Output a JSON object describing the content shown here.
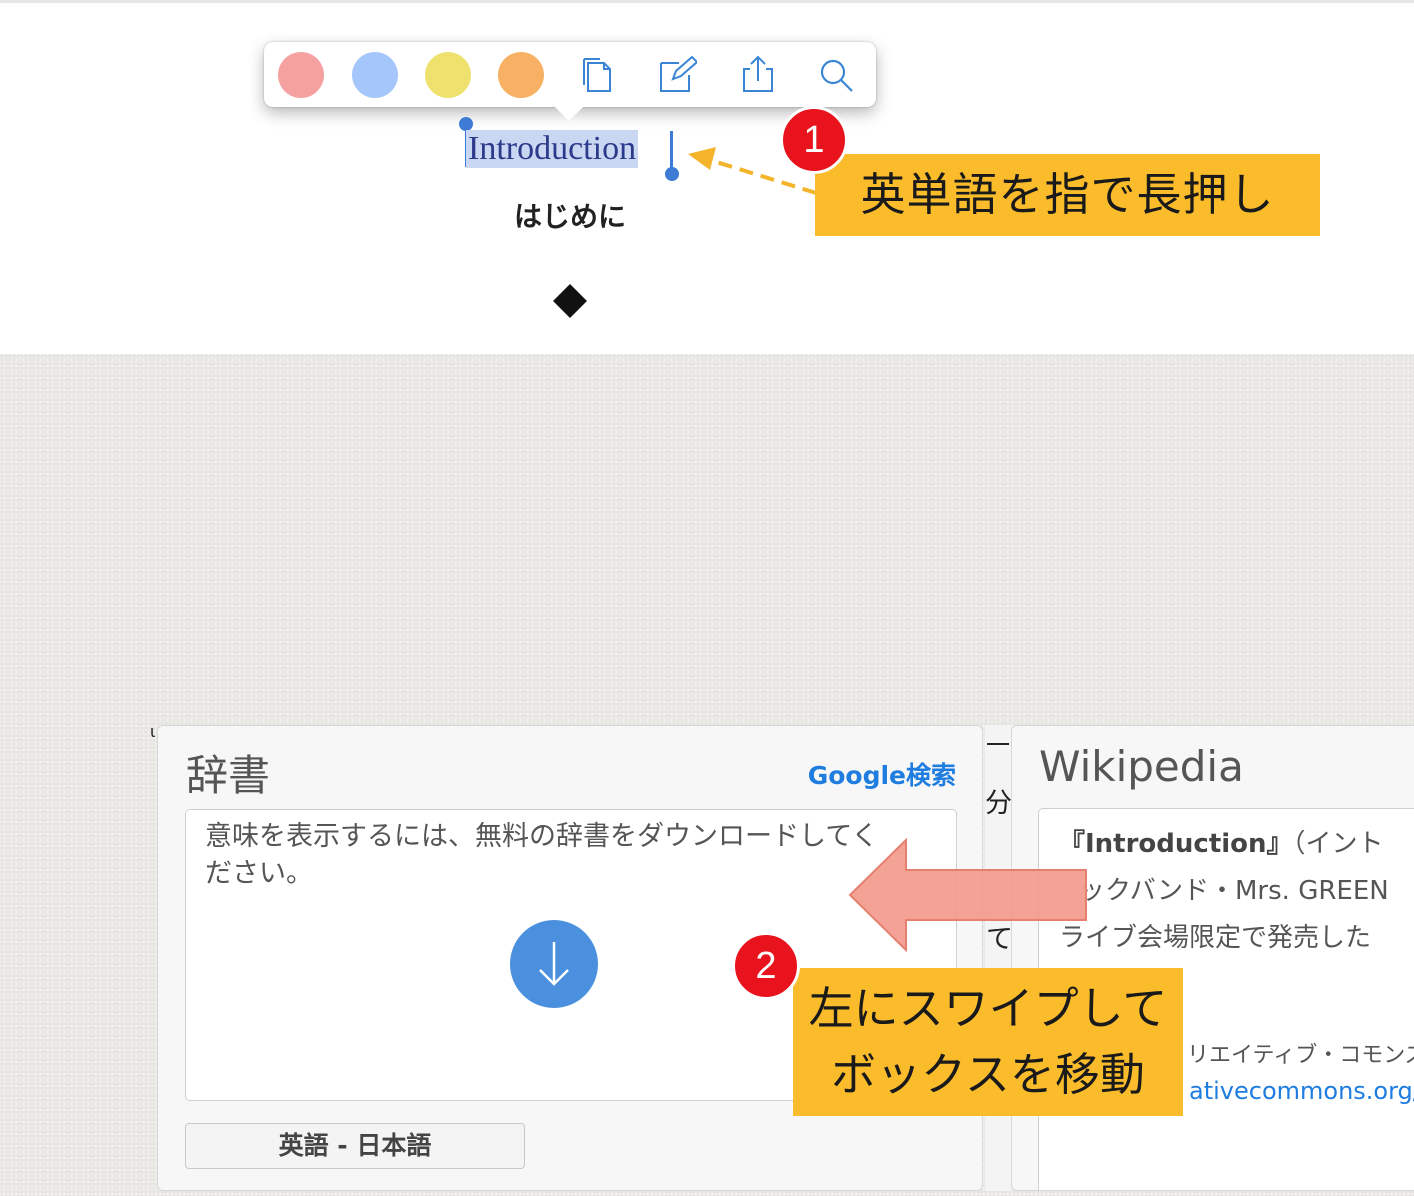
{
  "toolbar": {
    "swatches": [
      {
        "name": "red",
        "color": "#f4a1a0"
      },
      {
        "name": "blue",
        "color": "#a5c6fb"
      },
      {
        "name": "yellow",
        "color": "#efe16e"
      },
      {
        "name": "orange",
        "color": "#f7b064"
      }
    ],
    "icons": [
      "copy-icon",
      "note-icon",
      "share-icon",
      "search-icon"
    ],
    "icon_color": "#3a86d4"
  },
  "book": {
    "selected_word": "Introduction",
    "subtitle": "はじめに",
    "ornament": "◆"
  },
  "annotations": {
    "step1": {
      "number": "1",
      "text": "英単語を指で長押し"
    },
    "step2": {
      "number": "2",
      "line1": "左にスワイプして",
      "line2": "ボックスを移動"
    },
    "badge_color": "#e8131c",
    "callout_color": "#fbbc2c",
    "arrow_color": "#f29a8c"
  },
  "dictionary": {
    "title": "辞書",
    "google_link": "Google検索",
    "message": "意味を表示するには、無料の辞書をダウンロードしてください。",
    "language": "英語 - 日本語"
  },
  "page_strip": {
    "glyphs": [
      "一",
      "分",
      "て"
    ]
  },
  "wikipedia": {
    "title": "Wikipedia",
    "line1_bold": "『Introduction』",
    "line1_rest": "（イント",
    "line2": "ックバンド・Mrs. GREEN",
    "line3": "ライブ会場限定で発売した",
    "line4": "リエイティブ・コモンズ",
    "link": "ativecommons.org/lic"
  }
}
